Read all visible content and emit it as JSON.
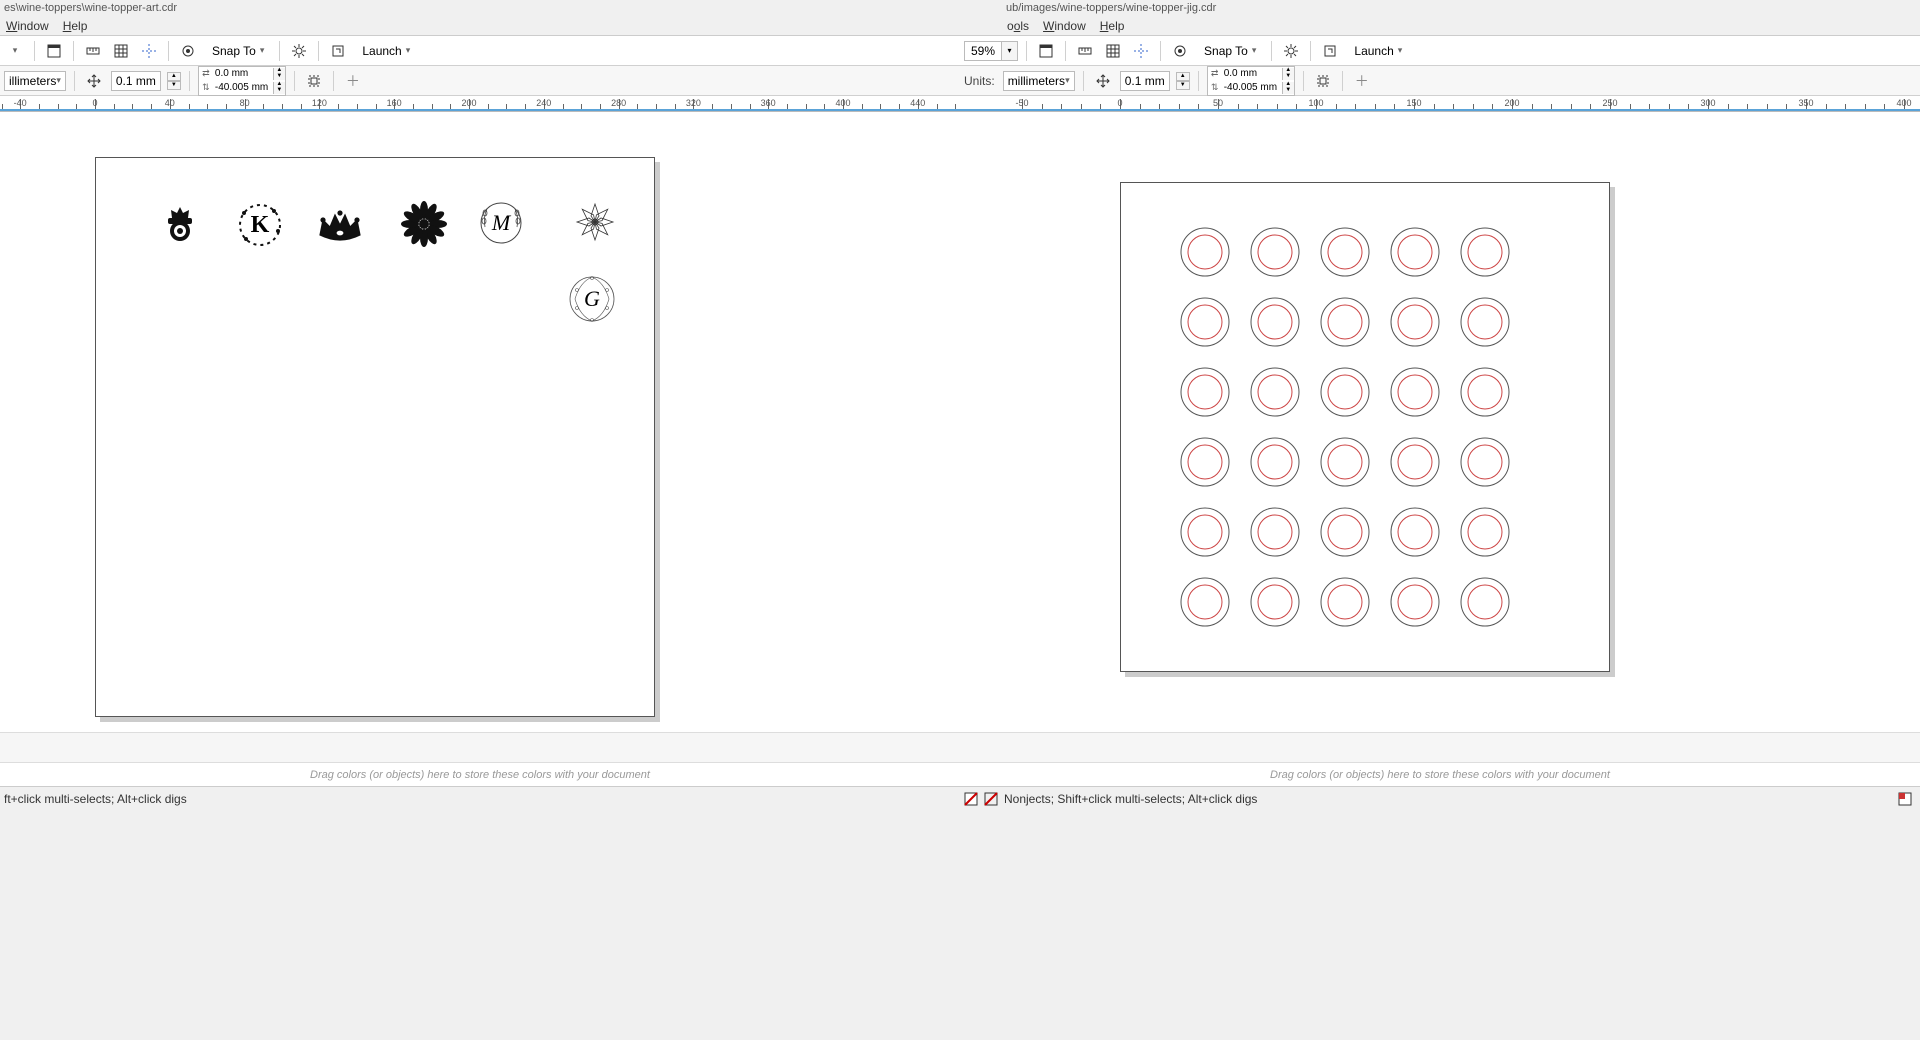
{
  "left": {
    "title": "es\\wine-toppers\\wine-topper-art.cdr",
    "menu": [
      "Window",
      "Help"
    ],
    "toolbar": {
      "snap_to": "Snap To",
      "launch": "Launch"
    },
    "props": {
      "units_label": "",
      "units": "illimeters",
      "nudge": "0.1 mm",
      "dx": "0.0 mm",
      "dy": "-40.005 mm"
    },
    "ruler": {
      "start": -80,
      "end": 750,
      "step": 40,
      "label_step": 40
    },
    "palette_hint": "Drag colors (or objects) here to store these colors with your document",
    "status": "ft+click multi-selects; Alt+click digs",
    "art_labels": {
      "k": "K",
      "m": "M",
      "g": "G"
    }
  },
  "right": {
    "title": "ub/images/wine-toppers/wine-topper-jig.cdr",
    "menu": [
      "ools",
      "Window",
      "Help"
    ],
    "toolbar": {
      "zoom": "59%",
      "snap_to": "Snap To",
      "launch": "Launch"
    },
    "props": {
      "units_label": "Units:",
      "units": "millimeters",
      "nudge": "0.1 mm",
      "dx": "0.0 mm",
      "dy": "-40.005 mm"
    },
    "ruler": {
      "start": -50,
      "end": 400,
      "step": 50,
      "label_step": 50
    },
    "palette_hint": "Drag colors (or objects) here to store these colors with your document",
    "status": "Nonjects; Shift+click multi-selects; Alt+click digs",
    "jig": {
      "rows": 6,
      "cols": 5
    }
  }
}
